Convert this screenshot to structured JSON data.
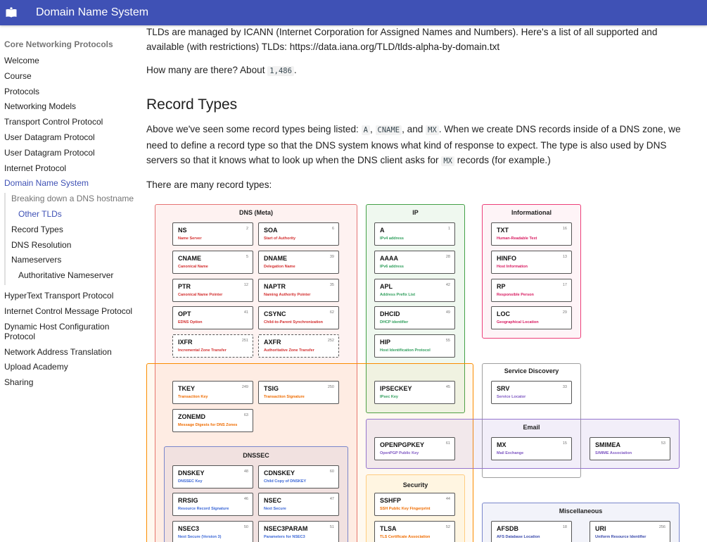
{
  "header": {
    "title": "Domain Name System",
    "logo_icon": "book-open-icon"
  },
  "sidebar": {
    "heading": "Core Networking Protocols",
    "items": [
      "Welcome",
      "Course",
      "Protocols",
      "Networking Models",
      "Transport Control Protocol",
      "User Datagram Protocol",
      "User Datagram Protocol",
      "Internet Protocol",
      "Domain Name System"
    ],
    "sub": [
      "Breaking down a DNS hostname",
      "Other TLDs",
      "Record Types",
      "DNS Resolution",
      "Nameservers",
      "Authoritative Nameserver"
    ],
    "items2": [
      "HyperText Transport Protocol",
      "Internet Control Message Protocol",
      "Dynamic Host Configuration Protocol",
      "Network Address Translation",
      "Upload Academy",
      "Sharing"
    ]
  },
  "content": {
    "tld_para": "TLDs are managed by ICANN (Internet Corporation for Assigned Names and Numbers). Here's a list of all supported and available (with restrictions) TLDs: https://data.iana.org/TLD/tlds-alpha-by-domain.txt",
    "count_prefix": "How many are there? About",
    "count_value": "1,486",
    "count_suffix": ".",
    "section_title": "Record Types",
    "rt_p1": "Above we've seen some record types being listed:",
    "rt_a": "A",
    "rt_sep1": ",",
    "rt_cname": "CNAME",
    "rt_sep2": ", and",
    "rt_mx": "MX",
    "rt_p2": ". When we create DNS records inside of a DNS zone, we need to define a record type so that the DNS system knows what kind of response to expect. The type is also used by DNS servers so that it knows what to look up when the DNS client asks for",
    "rt_mx2": "MX",
    "rt_p3": "records (for example.)",
    "many": "There are many record types:"
  },
  "diagram": {
    "groups": {
      "dns_meta": "DNS (Meta)",
      "ip": "IP",
      "informational": "Informational",
      "service_discovery": "Service Discovery",
      "email": "Email",
      "dnssec": "DNSSEC",
      "security": "Security",
      "misc": "Miscellaneous"
    },
    "records": [
      {
        "name": "NS",
        "desc": "Name Server",
        "num": "2"
      },
      {
        "name": "SOA",
        "desc": "Start of Authority",
        "num": "6"
      },
      {
        "name": "CNAME",
        "desc": "Canonical Name",
        "num": "5"
      },
      {
        "name": "DNAME",
        "desc": "Delegation Name",
        "num": "39"
      },
      {
        "name": "PTR",
        "desc": "Canonical Name Pointer",
        "num": "12"
      },
      {
        "name": "NAPTR",
        "desc": "Naming Authority Pointer",
        "num": "35"
      },
      {
        "name": "OPT",
        "desc": "EDNS Option",
        "num": "41"
      },
      {
        "name": "CSYNC",
        "desc": "Child-to-Parent Synchronization",
        "num": "62"
      },
      {
        "name": "IXFR",
        "desc": "Incremental Zone Transfer",
        "num": "251"
      },
      {
        "name": "AXFR",
        "desc": "Authoritative Zone Transfer",
        "num": "252"
      },
      {
        "name": "TKEY",
        "desc": "Transaction Key",
        "num": "249"
      },
      {
        "name": "TSIG",
        "desc": "Transaction Signature",
        "num": "250"
      },
      {
        "name": "ZONEMD",
        "desc": "Message Digests for DNS Zones",
        "num": "63"
      },
      {
        "name": "A",
        "desc": "IPv4 address",
        "num": "1"
      },
      {
        "name": "AAAA",
        "desc": "IPv6 address",
        "num": "28"
      },
      {
        "name": "APL",
        "desc": "Address Prefix List",
        "num": "42"
      },
      {
        "name": "DHCID",
        "desc": "DHCP identifier",
        "num": "49"
      },
      {
        "name": "HIP",
        "desc": "Host Identification Protocol",
        "num": "55"
      },
      {
        "name": "IPSECKEY",
        "desc": "IPsec Key",
        "num": "45"
      },
      {
        "name": "TXT",
        "desc": "Human-Readable Text",
        "num": "16"
      },
      {
        "name": "HINFO",
        "desc": "Host Information",
        "num": "13"
      },
      {
        "name": "RP",
        "desc": "Responsible Person",
        "num": "17"
      },
      {
        "name": "LOC",
        "desc": "Geographical Location",
        "num": "29"
      },
      {
        "name": "SRV",
        "desc": "Service Locator",
        "num": "33"
      },
      {
        "name": "OPENPGPKEY",
        "desc": "OpenPGP Public Key",
        "num": "61"
      },
      {
        "name": "MX",
        "desc": "Mail Exchange",
        "num": "15"
      },
      {
        "name": "SMIMEA",
        "desc": "S/MIME Association",
        "num": "53"
      },
      {
        "name": "DNSKEY",
        "desc": "DNSSEC Key",
        "num": "48"
      },
      {
        "name": "CDNSKEY",
        "desc": "Child Copy of DNSKEY",
        "num": "60"
      },
      {
        "name": "RRSIG",
        "desc": "Resource Record Signature",
        "num": "46"
      },
      {
        "name": "NSEC",
        "desc": "Next Secure",
        "num": "47"
      },
      {
        "name": "NSEC3",
        "desc": "Next Secure (Version 3)",
        "num": "50"
      },
      {
        "name": "NSEC3PARAM",
        "desc": "Parameters for NSEC3",
        "num": "51"
      },
      {
        "name": "SSHFP",
        "desc": "SSH Public Key Fingerprint",
        "num": "44"
      },
      {
        "name": "TLSA",
        "desc": "TLS Certificate Association",
        "num": "52"
      },
      {
        "name": "AFSDB",
        "desc": "AFS Database Location",
        "num": "18"
      },
      {
        "name": "URI",
        "desc": "Uniform Resource Identifier",
        "num": "256"
      }
    ]
  },
  "colors": {
    "header_bg": "#3f51b5",
    "active_link": "#3f51b5",
    "dns_meta": "#e53935",
    "ip": "#2e9e5b",
    "informational": "#d81b60",
    "orange": "#ef6c00",
    "email": "#7e57c2",
    "dnssec": "#3b67d6",
    "misc": "#3949ab"
  }
}
